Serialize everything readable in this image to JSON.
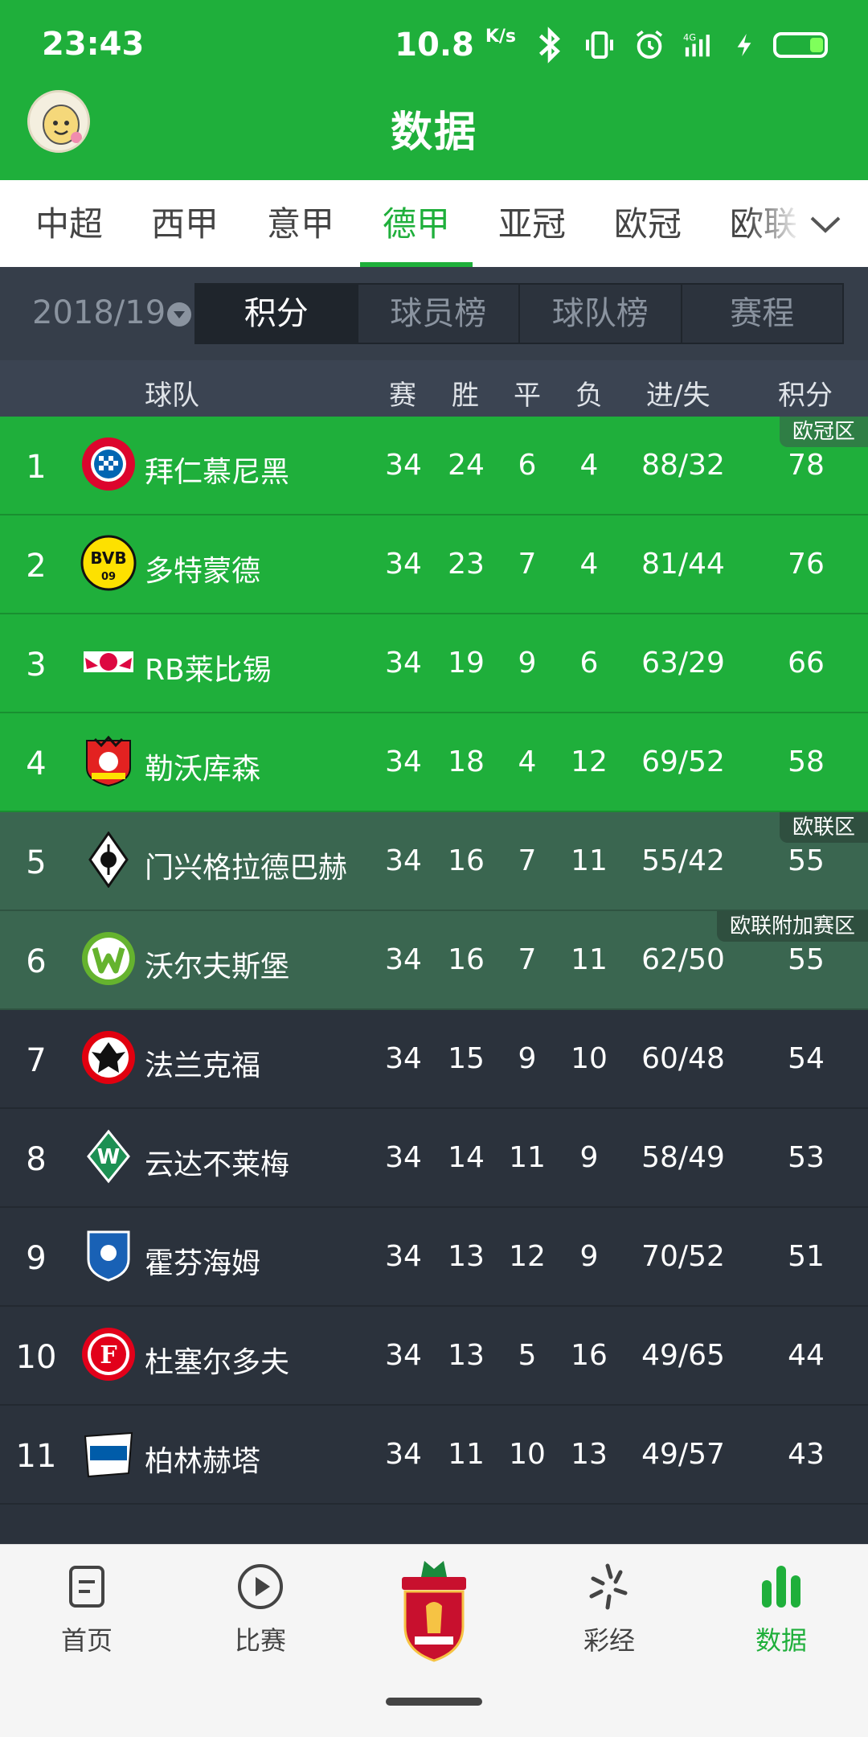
{
  "status_bar": {
    "time": "23:43",
    "net_speed": "10.8",
    "net_unit": "K/s"
  },
  "header": {
    "title": "数据"
  },
  "league_tabs": [
    {
      "label": "中超",
      "active": false
    },
    {
      "label": "西甲",
      "active": false
    },
    {
      "label": "意甲",
      "active": false
    },
    {
      "label": "德甲",
      "active": true
    },
    {
      "label": "亚冠",
      "active": false
    },
    {
      "label": "欧冠",
      "active": false
    },
    {
      "label": "欧联",
      "active": false
    }
  ],
  "season": "2018/19",
  "segments": [
    {
      "label": "积分",
      "active": true
    },
    {
      "label": "球员榜",
      "active": false
    },
    {
      "label": "球队榜",
      "active": false
    },
    {
      "label": "赛程",
      "active": false
    }
  ],
  "table_header": {
    "team": "球队",
    "played": "赛",
    "won": "胜",
    "drawn": "平",
    "lost": "负",
    "goals": "进/失",
    "points": "积分"
  },
  "rows": [
    {
      "rank": "1",
      "team": "拜仁慕尼黑",
      "played": "34",
      "won": "24",
      "drawn": "6",
      "lost": "4",
      "goals": "88/32",
      "points": "78",
      "zone": "ucl",
      "zone_tag": "欧冠区",
      "logo": "bayern-logo"
    },
    {
      "rank": "2",
      "team": "多特蒙德",
      "played": "34",
      "won": "23",
      "drawn": "7",
      "lost": "4",
      "goals": "81/44",
      "points": "76",
      "zone": "ucl",
      "zone_tag": "",
      "logo": "dortmund-logo"
    },
    {
      "rank": "3",
      "team": "RB莱比锡",
      "played": "34",
      "won": "19",
      "drawn": "9",
      "lost": "6",
      "goals": "63/29",
      "points": "66",
      "zone": "ucl",
      "zone_tag": "",
      "logo": "leipzig-logo"
    },
    {
      "rank": "4",
      "team": "勒沃库森",
      "played": "34",
      "won": "18",
      "drawn": "4",
      "lost": "12",
      "goals": "69/52",
      "points": "58",
      "zone": "ucl",
      "zone_tag": "",
      "logo": "leverkusen-logo"
    },
    {
      "rank": "5",
      "team": "门兴格拉德巴赫",
      "played": "34",
      "won": "16",
      "drawn": "7",
      "lost": "11",
      "goals": "55/42",
      "points": "55",
      "zone": "uel",
      "zone_tag": "欧联区",
      "logo": "gladbach-logo"
    },
    {
      "rank": "6",
      "team": "沃尔夫斯堡",
      "played": "34",
      "won": "16",
      "drawn": "7",
      "lost": "11",
      "goals": "62/50",
      "points": "55",
      "zone": "uel",
      "zone_tag": "欧联附加赛区",
      "logo": "wolfsburg-logo"
    },
    {
      "rank": "7",
      "team": "法兰克福",
      "played": "34",
      "won": "15",
      "drawn": "9",
      "lost": "10",
      "goals": "60/48",
      "points": "54",
      "zone": "none",
      "zone_tag": "",
      "logo": "frankfurt-logo"
    },
    {
      "rank": "8",
      "team": "云达不莱梅",
      "played": "34",
      "won": "14",
      "drawn": "11",
      "lost": "9",
      "goals": "58/49",
      "points": "53",
      "zone": "none",
      "zone_tag": "",
      "logo": "bremen-logo"
    },
    {
      "rank": "9",
      "team": "霍芬海姆",
      "played": "34",
      "won": "13",
      "drawn": "12",
      "lost": "9",
      "goals": "70/52",
      "points": "51",
      "zone": "none",
      "zone_tag": "",
      "logo": "hoffenheim-logo"
    },
    {
      "rank": "10",
      "team": "杜塞尔多夫",
      "played": "34",
      "won": "13",
      "drawn": "5",
      "lost": "16",
      "goals": "49/65",
      "points": "44",
      "zone": "none",
      "zone_tag": "",
      "logo": "dusseldorf-logo"
    },
    {
      "rank": "11",
      "team": "柏林赫塔",
      "played": "34",
      "won": "11",
      "drawn": "10",
      "lost": "13",
      "goals": "49/57",
      "points": "43",
      "zone": "none",
      "zone_tag": "",
      "logo": "hertha-logo"
    }
  ],
  "bottom_nav": [
    {
      "label": "首页",
      "icon": "home-doc-icon",
      "active": false
    },
    {
      "label": "比赛",
      "icon": "play-circle-icon",
      "active": false
    },
    {
      "label": "",
      "icon": "liverpool-crest-icon",
      "active": false
    },
    {
      "label": "彩经",
      "icon": "lottery-icon",
      "active": false
    },
    {
      "label": "数据",
      "icon": "bar-chart-icon",
      "active": true
    }
  ],
  "colors": {
    "brand_green": "#1faf3b",
    "ucl_row": "#1faf3b",
    "uel_row": "#3a6650",
    "dark_row": "#2b323c"
  }
}
